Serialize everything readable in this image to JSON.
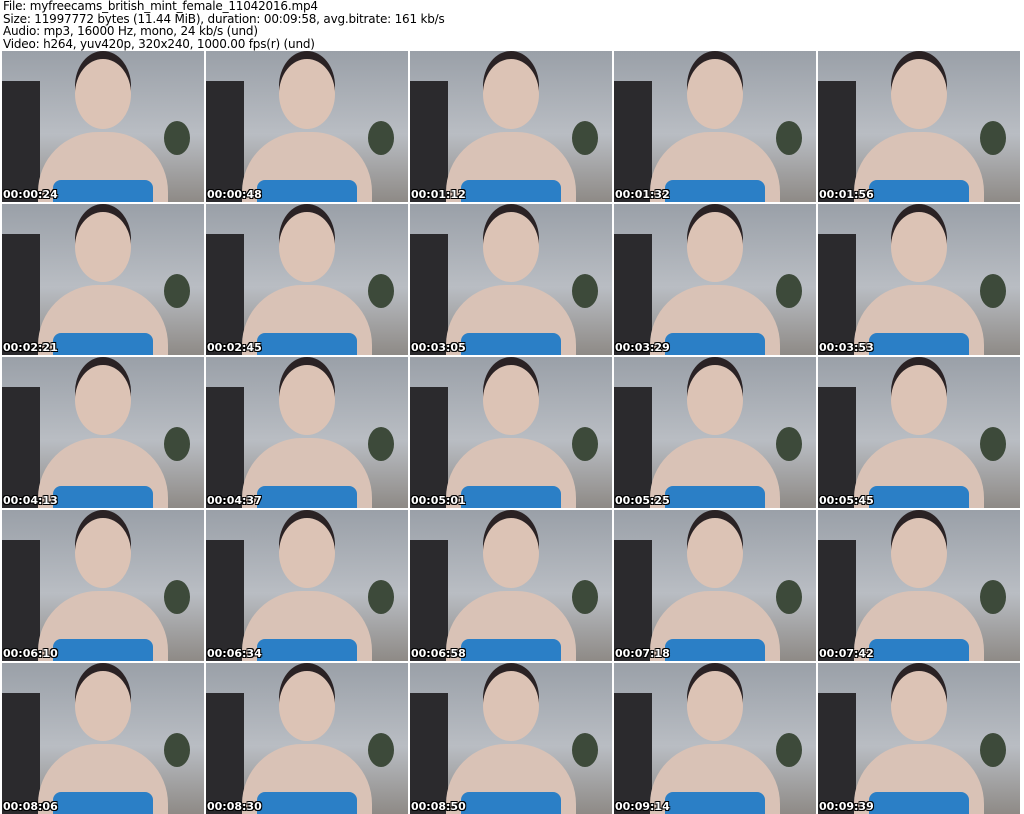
{
  "header": {
    "file": "File: myfreecams_british_mint_female_11042016.mp4",
    "size": "Size: 11997772 bytes (11.44 MiB), duration: 00:09:58, avg.bitrate: 161 kb/s",
    "audio": "Audio: mp3, 16000 Hz, mono, 24 kb/s (und)",
    "video": "Video: h264, yuv420p, 320x240, 1000.00 fps(r) (und)"
  },
  "thumbnails": [
    "00:00:24",
    "00:00:48",
    "00:01:12",
    "00:01:32",
    "00:01:56",
    "00:02:21",
    "00:02:45",
    "00:03:05",
    "00:03:29",
    "00:03:53",
    "00:04:13",
    "00:04:37",
    "00:05:01",
    "00:05:25",
    "00:05:45",
    "00:06:10",
    "00:06:34",
    "00:06:58",
    "00:07:18",
    "00:07:42",
    "00:08:06",
    "00:08:30",
    "00:08:50",
    "00:09:14",
    "00:09:39"
  ]
}
